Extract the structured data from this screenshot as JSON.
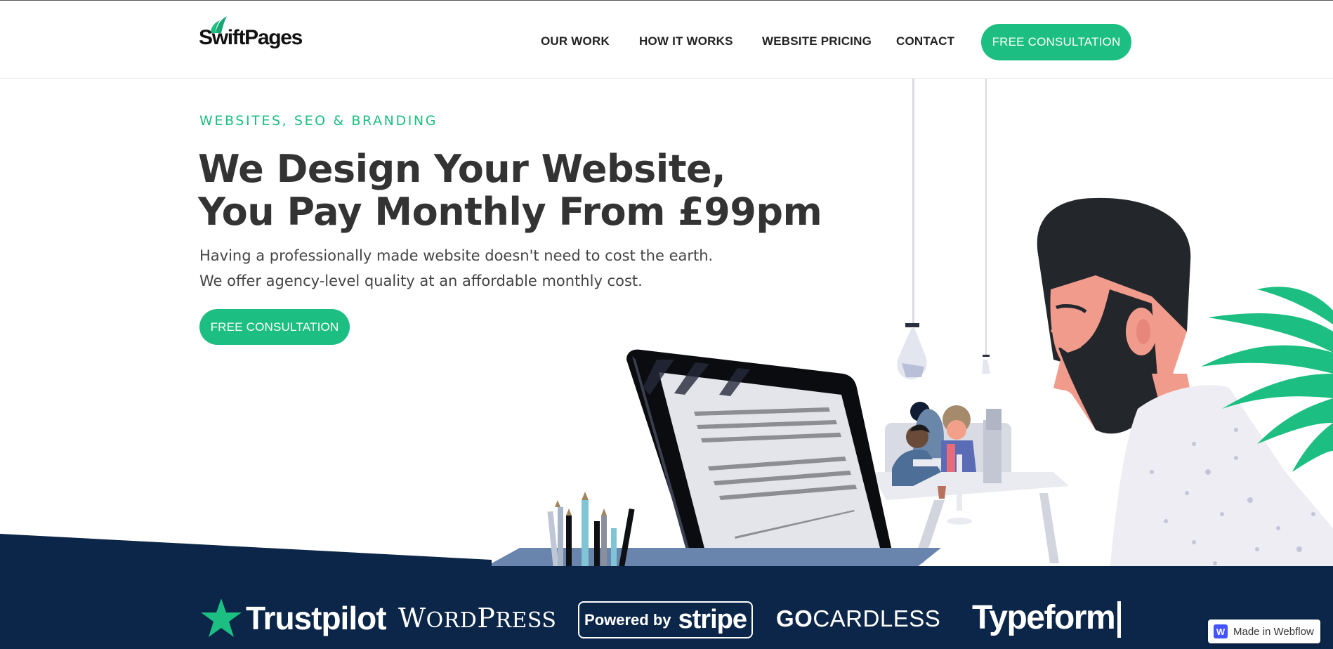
{
  "brand": {
    "logo_text": "SwiftPages"
  },
  "nav": {
    "links": [
      "OUR WORK",
      "HOW IT WORKS",
      "WEBSITE PRICING",
      "CONTACT"
    ],
    "cta": "FREE CONSULTATION"
  },
  "hero": {
    "eyebrow": "WEBSITES, SEO & BRANDING",
    "headline_line1": "We Design Your Website,",
    "headline_line2": "You Pay Monthly From £99pm",
    "sub_line1": "Having a professionally made website doesn't need to cost the earth.",
    "sub_line2": "We offer agency-level quality at an affordable monthly cost.",
    "cta": "FREE CONSULTATION"
  },
  "partners": {
    "trustpilot": "Trustpilot",
    "wordpress_first": "W",
    "wordpress_mid": "ORD",
    "wordpress_p": "P",
    "wordpress_rest": "RESS",
    "stripe_pre": "Powered by",
    "stripe_name": "stripe",
    "gocardless_bold": "GO",
    "gocardless_rest": "CARDLESS",
    "typeform": "Typeform"
  },
  "badge": {
    "icon_letter": "W",
    "text": "Made in Webflow"
  },
  "colors": {
    "accent": "#1cbf81",
    "band": "#0c2649",
    "text": "#333333"
  }
}
